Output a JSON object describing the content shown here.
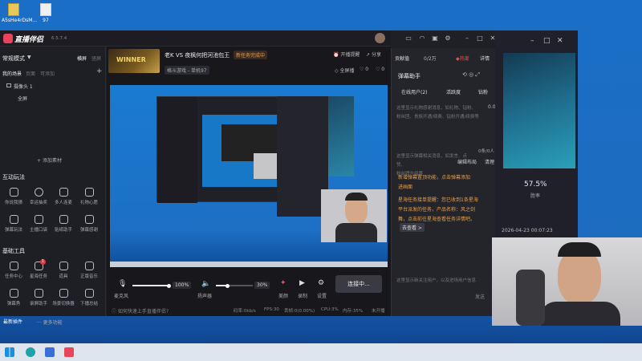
{
  "desktop": {
    "icons": [
      {
        "label": "A5sHe4rDsM..."
      },
      {
        "label": "97"
      }
    ],
    "bottom_left_label": "最新插件"
  },
  "app": {
    "title": "直播伴侣",
    "version": "6.5.7.4",
    "mode": "常规模式",
    "mode_tabs": [
      "横屏",
      "竖屏"
    ],
    "scene_tabs": [
      "我的场景",
      "页面",
      "可添加"
    ],
    "sources_label": "摄像头 1",
    "sources_sub": "全屏",
    "add_source": "添加素材",
    "interaction_title": "互动玩法",
    "interaction_tools": [
      "你说我猜",
      "幸运抽奖",
      "多人连麦",
      "礼物心愿",
      "弹幕玩法",
      "主播口袋",
      "贴纸助手",
      "弹幕感谢"
    ],
    "basic_title": "基础工具",
    "basic_tools": [
      "任务中心",
      "星海任务",
      "道具",
      "正版音乐",
      "弹幕秀",
      "录屏助手",
      "场景切换器",
      "下播总结"
    ],
    "basic_badge": "1",
    "more_label": "更多功能",
    "stream_title": "老K VS 夜枫何把河池包王",
    "stream_tag": "新任务完成中",
    "stream_category": "格斗游戏 - 单机97",
    "banner_text": "WINNER",
    "header_links": [
      "开播提醒",
      "分享"
    ],
    "fullscreen": "全屏播",
    "likes": "0",
    "viewers": "0",
    "mic_label": "麦克风",
    "mic_value": "100%",
    "speaker_label": "扬声器",
    "speaker_value": "30%",
    "ctrl_labels": [
      "美颜",
      "录制",
      "设置"
    ],
    "connect_button": "连接中...",
    "help_text": "如何快速上手直播伴侣?",
    "status": {
      "bitrate": "码率:0kb/s",
      "fps": "FPS:30",
      "drop": "丢帧:0(0.00%)",
      "cpu": "CPU:3%",
      "memory": "内存:35%",
      "stream_state": "未开播"
    }
  },
  "right_panel": {
    "tabs": [
      "贡献值",
      "0/2万",
      "热度",
      "详情"
    ],
    "danmu_title": "弹幕助手",
    "sub_tabs": [
      "在线用户(2)",
      "活跃度",
      "钻粉"
    ],
    "placeholder1": "这里显示礼物感谢消息，如礼物、钻粉、",
    "placeholder1b": "粉丝团、贵族开通/续费、钻粉开通/续费等",
    "gift_count": "0.0",
    "placeholder2": "这里显示弹幕相关消息，如发言、点赞、",
    "placeholder2b": "粉丝牌升级等",
    "count": "0条/0人",
    "edit_layout": "编辑布局",
    "clear": "清理",
    "notice1": "新增弹幕置顶功能，点击弹幕添加",
    "notice1b": "进画面",
    "notice2": "星海任务接单提醒：您已收到1条星海",
    "notice2b": "平台派发的任务，产品名称：风之剑",
    "notice2c": "舞，点击前往星海查看任务详情吧。",
    "go_view": "去查看 >",
    "placeholder3": "这里显示新关注用户，以及进场用户信息",
    "send": "发送"
  },
  "back_window": {
    "percent": "57.5%",
    "percent_label": "胜率",
    "datetime": "2026-04-23 00:07:23"
  },
  "colors": {
    "accent": "#e05545",
    "link": "#4ea0ff",
    "notice": "#e8a04c"
  }
}
